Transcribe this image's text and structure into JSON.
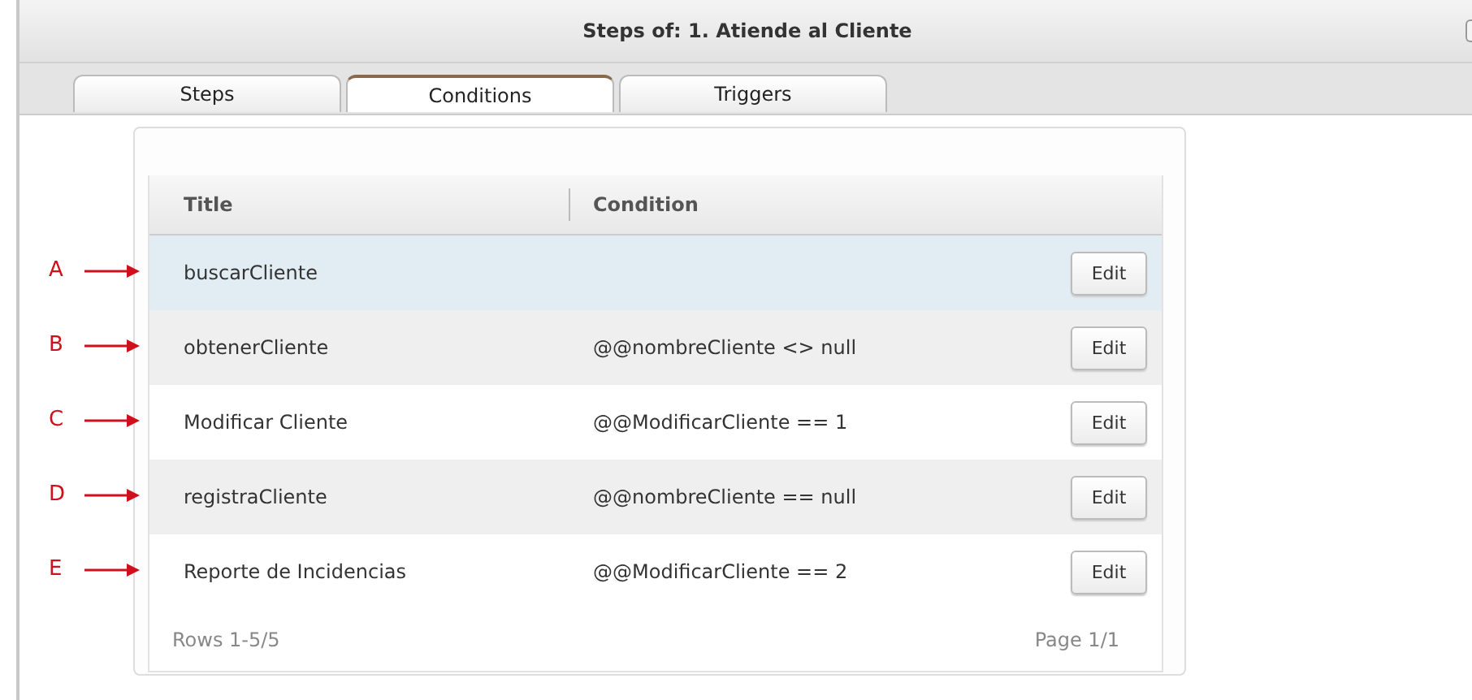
{
  "window": {
    "title": "Steps of: 1. Atiende al Cliente"
  },
  "tabs": [
    {
      "label": "Steps",
      "selected": false
    },
    {
      "label": "Conditions",
      "selected": true
    },
    {
      "label": "Triggers",
      "selected": false
    }
  ],
  "table": {
    "columns": [
      "Title",
      "Condition"
    ],
    "rows": [
      {
        "marker": "A",
        "title": "buscarCliente",
        "condition": "",
        "action": "Edit",
        "selected": true
      },
      {
        "marker": "B",
        "title": "obtenerCliente",
        "condition": "@@nombreCliente <> null",
        "action": "Edit",
        "selected": false
      },
      {
        "marker": "C",
        "title": "Modificar Cliente",
        "condition": "@@ModificarCliente == 1",
        "action": "Edit",
        "selected": false
      },
      {
        "marker": "D",
        "title": "registraCliente",
        "condition": "@@nombreCliente == null",
        "action": "Edit",
        "selected": false
      },
      {
        "marker": "E",
        "title": "Reporte de Incidencias",
        "condition": "@@ModificarCliente == 2",
        "action": "Edit",
        "selected": false
      }
    ],
    "footer": {
      "rows": "Rows 1-5/5",
      "page": "Page 1/1"
    }
  }
}
